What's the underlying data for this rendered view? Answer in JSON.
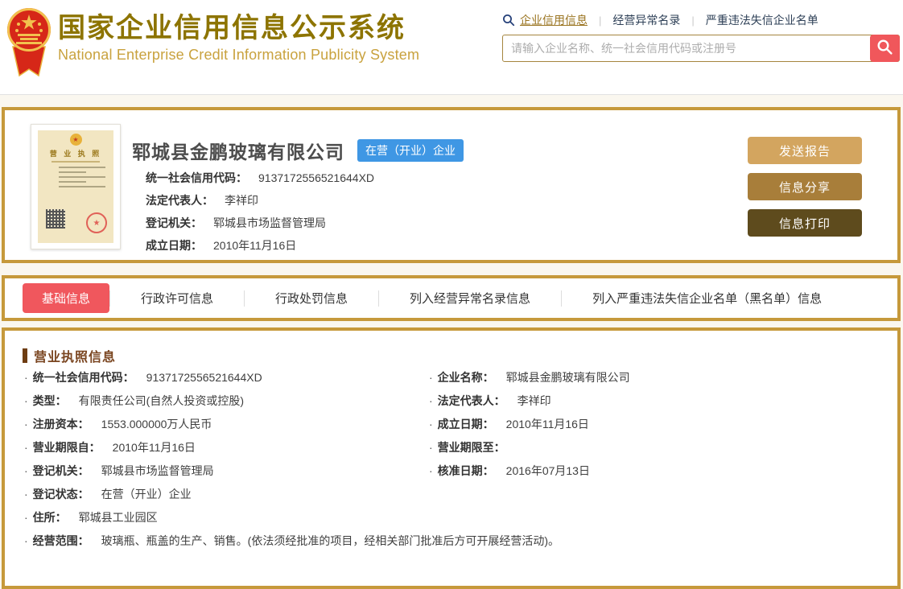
{
  "header": {
    "title_cn": "国家企业信用信息公示系统",
    "title_en": "National Enterprise Credit Information Publicity System",
    "search_tabs": [
      {
        "label": "企业信用信息",
        "active": true
      },
      {
        "label": "经营异常名录",
        "active": false
      },
      {
        "label": "严重违法失信企业名单",
        "active": false
      }
    ],
    "search_placeholder": "请输入企业名称、统一社会信用代码或注册号"
  },
  "company_card": {
    "license_title": "营 业 执 照",
    "name": "郓城县金鹏玻璃有限公司",
    "status_badge": "在营（开业）企业",
    "fields": [
      {
        "label": "统一社会信用代码：",
        "value": "9137172556521644XD"
      },
      {
        "label": "法定代表人：",
        "value": "李祥印"
      },
      {
        "label": "登记机关：",
        "value": "郓城县市场监督管理局"
      },
      {
        "label": "成立日期：",
        "value": "2010年11月16日"
      }
    ],
    "buttons": [
      {
        "label": "发送报告"
      },
      {
        "label": "信息分享"
      },
      {
        "label": "信息打印"
      }
    ]
  },
  "tabs": [
    {
      "label": "基础信息",
      "active": true
    },
    {
      "label": "行政许可信息",
      "active": false
    },
    {
      "label": "行政处罚信息",
      "active": false
    },
    {
      "label": "列入经营异常名录信息",
      "active": false
    },
    {
      "label": "列入严重违法失信企业名单（黑名单）信息",
      "active": false
    }
  ],
  "detail": {
    "section_title": "营业执照信息",
    "left_fields": [
      {
        "label": "统一社会信用代码：",
        "value": "9137172556521644XD"
      },
      {
        "label": "类型：",
        "value": "有限责任公司(自然人投资或控股)"
      },
      {
        "label": "注册资本：",
        "value": "1553.000000万人民币"
      },
      {
        "label": "营业期限自：",
        "value": "2010年11月16日"
      },
      {
        "label": "登记机关：",
        "value": "郓城县市场监督管理局"
      },
      {
        "label": "登记状态：",
        "value": "在营（开业）企业"
      },
      {
        "label": "住所：",
        "value": "郓城县工业园区"
      },
      {
        "label": "经营范围：",
        "value": "玻璃瓶、瓶盖的生产、销售。(依法须经批准的项目，经相关部门批准后方可开展经营活动)。"
      }
    ],
    "right_fields": [
      {
        "label": "企业名称：",
        "value": "郓城县金鹏玻璃有限公司"
      },
      {
        "label": "法定代表人：",
        "value": "李祥印"
      },
      {
        "label": "成立日期：",
        "value": "2010年11月16日"
      },
      {
        "label": "营业期限至：",
        "value": ""
      },
      {
        "label": "核准日期：",
        "value": "2016年07月13日"
      }
    ]
  },
  "icons": {
    "header_search_icon": "magnifier",
    "search_button_icon": "magnifier",
    "national_emblem": "prc-national-emblem",
    "license_seal": "red-round-seal",
    "license_qr": "qr-code"
  },
  "colors": {
    "gold_border": "#C6993B",
    "title_gold": "#8D7400",
    "subtitle_gold": "#C9A23E",
    "active_tab_red": "#F0575D",
    "search_button_red": "#F0575B",
    "status_badge_blue": "#3F97E4",
    "button_tan": "#D3A55F",
    "button_brown": "#A87E3A",
    "button_dark_brown": "#5E4B1D",
    "section_brown": "#7A4520",
    "page_cream": "#FAF7EF"
  }
}
